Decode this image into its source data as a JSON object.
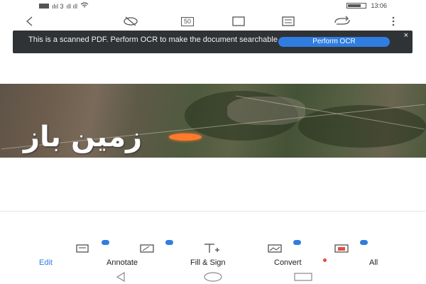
{
  "status_bar": {
    "carrier": "ılıl 3",
    "signal_note": "ıll ıll",
    "time": "13:06"
  },
  "toolbar": {
    "back_icon": "back-arrow-icon",
    "counter": "50"
  },
  "ocr_banner": {
    "message": "This is a scanned PDF. Perform OCR to make the document searchable",
    "button_label": "Perform OCR",
    "close_label": "×"
  },
  "document": {
    "watermark_text": "زمین باز"
  },
  "tabs": [
    {
      "label": "Edit",
      "active": true
    },
    {
      "label": "Annotate",
      "active": false
    },
    {
      "label": "Fill & Sign",
      "active": false
    },
    {
      "label": "Convert",
      "active": false,
      "badge": true
    },
    {
      "label": "All",
      "active": false
    }
  ],
  "colors": {
    "accent": "#2f7de1",
    "banner_bg": "#2f3336",
    "highlight": "#ff7a2a",
    "badge": "#e74c3c"
  }
}
